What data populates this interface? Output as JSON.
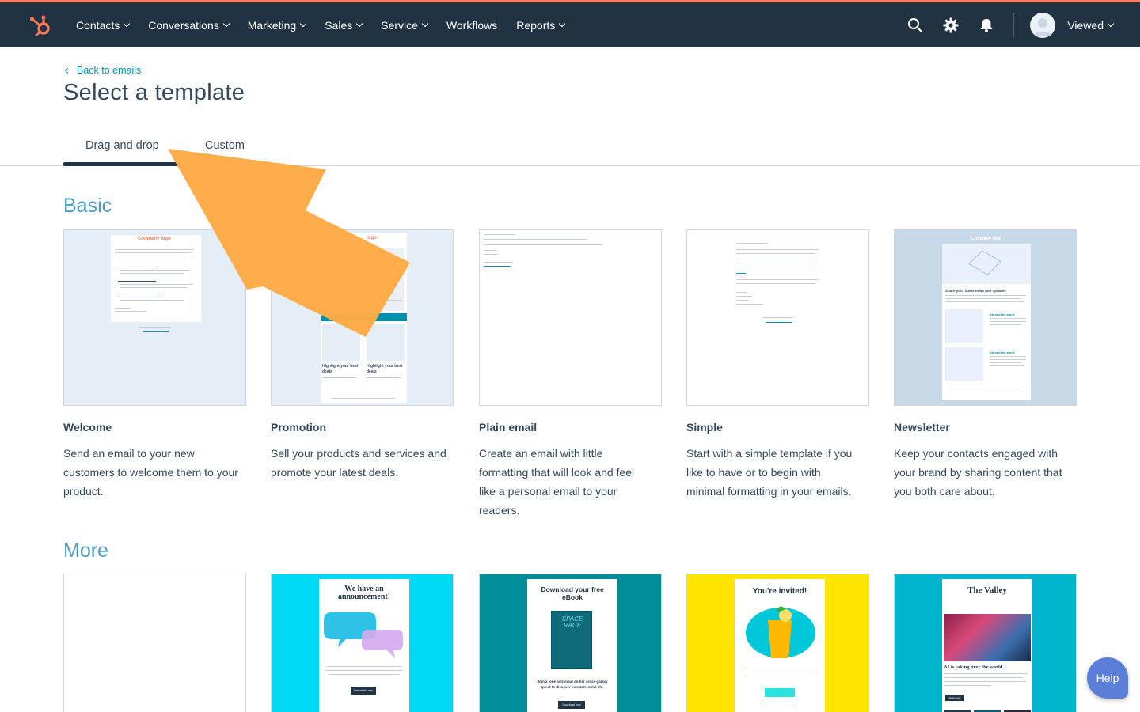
{
  "nav": {
    "items": [
      {
        "label": "Contacts",
        "has_menu": true
      },
      {
        "label": "Conversations",
        "has_menu": true
      },
      {
        "label": "Marketing",
        "has_menu": true
      },
      {
        "label": "Sales",
        "has_menu": true
      },
      {
        "label": "Service",
        "has_menu": true
      },
      {
        "label": "Workflows",
        "has_menu": false
      },
      {
        "label": "Reports",
        "has_menu": true
      }
    ],
    "account_label": "Viewed",
    "icons": [
      "search-icon",
      "gear-icon",
      "bell-icon"
    ]
  },
  "header": {
    "back_link": "Back to emails",
    "title": "Select a template"
  },
  "tabs": [
    {
      "label": "Drag and drop",
      "active": true
    },
    {
      "label": "Custom",
      "active": false
    }
  ],
  "sections": {
    "basic": "Basic",
    "more": "More"
  },
  "basic_templates": [
    {
      "name": "Welcome",
      "desc_lines": [
        "Send an email to your new",
        "customers to welcome them to your",
        "product."
      ],
      "preview_logo": "Company logo"
    },
    {
      "name": "Promotion",
      "desc_lines": [
        "Sell your products and services and",
        "promote your latest deals."
      ],
      "preview_logo": "logo",
      "preview_deal": "Highlight your best deals"
    },
    {
      "name": "Plain email",
      "desc_lines": [
        "Create an email with little",
        "formatting that will look and feel",
        "like a personal email to your",
        "readers."
      ]
    },
    {
      "name": "Simple",
      "desc_lines": [
        "Start with a simple template if you",
        "like to have or to begin with",
        "minimal formatting in your emails."
      ]
    },
    {
      "name": "Newsletter",
      "desc_lines": [
        "Keep your contacts engaged with",
        "your brand by sharing content that",
        "you both care about."
      ],
      "preview_logo": "Company logo",
      "preview_heading": "Share your latest news and updates",
      "preview_sub": "Spread the word"
    }
  ],
  "more_templates": [
    {
      "preview_title": ""
    },
    {
      "preview_title": "We have an announcement!",
      "preview_button": "See what's new"
    },
    {
      "preview_title": "Download your free eBook",
      "preview_book": "SPACE RACE",
      "preview_tagline": "Join a lone astronaut on her cross-galaxy quest to discover extraterrestrial life.",
      "preview_button": "Download now"
    },
    {
      "preview_title": "You're invited!"
    },
    {
      "preview_title": "The Valley",
      "preview_heading": "AI is taking over the world",
      "preview_button": "Read more"
    }
  ],
  "help_label": "Help",
  "colors": {
    "nav_bg": "#213343",
    "accent_orange": "#ff7a59",
    "link_teal": "#0091ae",
    "section_blue": "#4f9ec2",
    "arrow": "#ffaa44"
  }
}
